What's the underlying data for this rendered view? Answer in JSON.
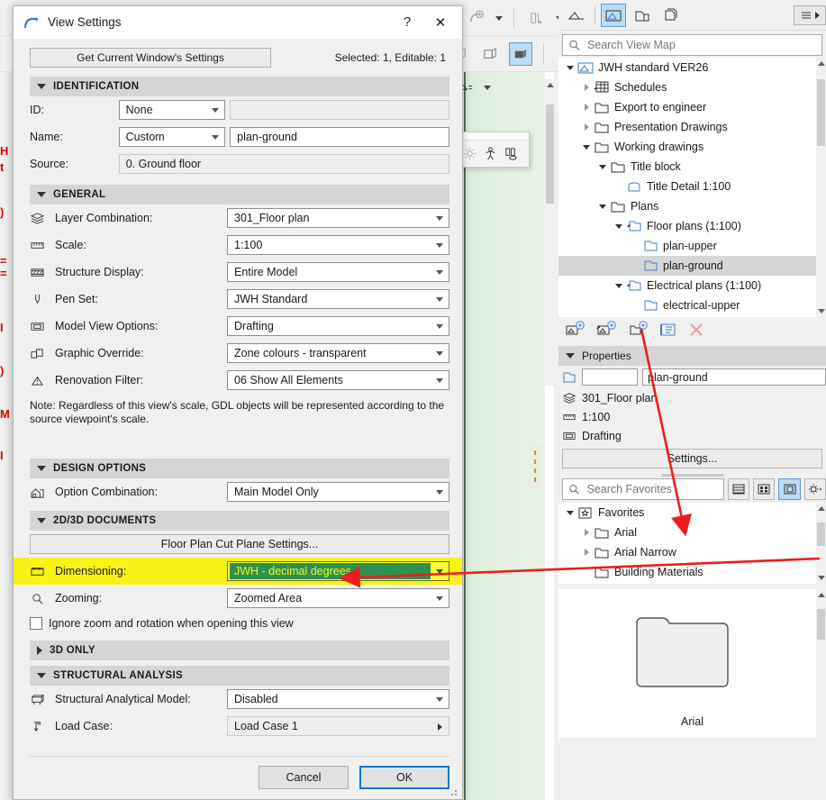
{
  "dialog": {
    "title": "View Settings",
    "help_label": "?",
    "close_label": "✕",
    "get_current_button": "Get Current Window's Settings",
    "selected_editable": "Selected: 1, Editable: 1",
    "groups": {
      "identification": {
        "title": "IDENTIFICATION",
        "rows": {
          "id_label": "ID:",
          "id_value": "None",
          "id_text": "",
          "name_label": "Name:",
          "name_value": "Custom",
          "name_text": "plan-ground",
          "source_label": "Source:",
          "source_value": "0. Ground floor"
        }
      },
      "general": {
        "title": "GENERAL",
        "rows": [
          {
            "label": "Layer Combination:",
            "value": "301_Floor plan",
            "icon": "layers-icon"
          },
          {
            "label": "Scale:",
            "value": "1:100",
            "icon": "ruler-icon"
          },
          {
            "label": "Structure Display:",
            "value": "Entire Model",
            "icon": "structure-icon"
          },
          {
            "label": "Pen Set:",
            "value": "JWH Standard",
            "icon": "pen-icon"
          },
          {
            "label": "Model View Options:",
            "value": "Drafting",
            "icon": "model-view-icon"
          },
          {
            "label": "Graphic Override:",
            "value": "Zone colours - transparent",
            "icon": "graphic-override-icon"
          },
          {
            "label": "Renovation Filter:",
            "value": "06 Show All Elements",
            "icon": "renovation-icon"
          }
        ],
        "note": "Note: Regardless of this view's scale, GDL objects will be represented according to the source viewpoint's scale."
      },
      "design_options": {
        "title": "DESIGN OPTIONS",
        "rows": [
          {
            "label": "Option Combination:",
            "value": "Main Model Only",
            "icon": "design-option-icon"
          }
        ]
      },
      "documents_2d3d": {
        "title": "2D/3D DOCUMENTS",
        "cut_plane_button": "Floor Plan Cut Plane Settings...",
        "rows": [
          {
            "label": "Dimensioning:",
            "value": "JWH - decimal degrees",
            "icon": "dimension-icon",
            "highlighted": true
          },
          {
            "label": "Zooming:",
            "value": "Zoomed Area",
            "icon": "magnifier-icon",
            "highlighted": false
          }
        ],
        "checkbox_label": "Ignore zoom and rotation when opening this view",
        "checkbox_checked": false
      },
      "three_d_only": {
        "title": "3D ONLY",
        "collapsed": true
      },
      "structural_analysis": {
        "title": "STRUCTURAL ANALYSIS",
        "rows": [
          {
            "label": "Structural Analytical Model:",
            "value": "Disabled",
            "icon": "structural-model-icon",
            "type": "combo"
          },
          {
            "label": "Load Case:",
            "value": "Load Case 1",
            "icon": "load-case-icon",
            "type": "popup"
          }
        ]
      }
    },
    "footer": {
      "cancel": "Cancel",
      "ok": "OK"
    }
  },
  "right_panel": {
    "tabs": [
      {
        "name": "project-map-tab",
        "icon": "project-map-icon",
        "selected": false
      },
      {
        "name": "view-map-tab",
        "icon": "view-map-icon",
        "selected": true
      },
      {
        "name": "layout-book-tab",
        "icon": "layout-book-icon",
        "selected": false
      },
      {
        "name": "publisher-sets-tab",
        "icon": "publisher-icon",
        "selected": false
      }
    ],
    "menu_icon": "hamburger-icon",
    "search": {
      "placeholder": "Search View Map",
      "value": ""
    },
    "tree": [
      {
        "label": "JWH standard VER26",
        "depth": 0,
        "twist": "down",
        "icon": "project-icon",
        "selected": false
      },
      {
        "label": "Schedules",
        "depth": 1,
        "twist": "right",
        "icon": "schedule-icon",
        "selected": false
      },
      {
        "label": "Export to engineer",
        "depth": 1,
        "twist": "right",
        "icon": "folder-icon",
        "selected": false
      },
      {
        "label": "Presentation Drawings",
        "depth": 1,
        "twist": "right",
        "icon": "folder-icon",
        "selected": false
      },
      {
        "label": "Working drawings",
        "depth": 1,
        "twist": "down",
        "icon": "folder-icon",
        "selected": false
      },
      {
        "label": "Title block",
        "depth": 2,
        "twist": "down",
        "icon": "folder-icon",
        "selected": false
      },
      {
        "label": "Title Detail 1:100",
        "depth": 3,
        "twist": "none",
        "icon": "detail-icon",
        "selected": false
      },
      {
        "label": "Plans",
        "depth": 2,
        "twist": "down",
        "icon": "folder-icon",
        "selected": false
      },
      {
        "label": "Floor plans (1:100)",
        "depth": 3,
        "twist": "down",
        "icon": "floorplan-set-icon",
        "selected": false
      },
      {
        "label": "plan-upper",
        "depth": 4,
        "twist": "none",
        "icon": "view-icon",
        "selected": false
      },
      {
        "label": "plan-ground",
        "depth": 4,
        "twist": "none",
        "icon": "view-icon",
        "selected": true
      },
      {
        "label": "Electrical plans (1:100)",
        "depth": 3,
        "twist": "down",
        "icon": "floorplan-set-icon",
        "selected": false
      },
      {
        "label": "electrical-upper",
        "depth": 4,
        "twist": "none",
        "icon": "view-icon",
        "selected": false
      }
    ],
    "tree_toolbar": [
      {
        "name": "save-view-button",
        "icon": "save-view-icon"
      },
      {
        "name": "save-clone-view-button",
        "icon": "save-clone-icon"
      },
      {
        "name": "new-folder-button",
        "icon": "new-folder-icon"
      },
      {
        "name": "view-settings-button",
        "icon": "settings-list-icon"
      },
      {
        "name": "delete-button",
        "icon": "delete-x-icon"
      }
    ],
    "properties": {
      "title": "Properties",
      "id_value": "",
      "name_value": "plan-ground",
      "layer_combination": "301_Floor plan",
      "scale": "1:100",
      "model_view_options": "Drafting",
      "settings_button": "Settings..."
    },
    "favorites": {
      "search_placeholder": "Search Favorites",
      "view_buttons": [
        {
          "name": "list-view-button",
          "icon": "list-icon",
          "selected": false
        },
        {
          "name": "grid-view-button",
          "icon": "grid-icon",
          "selected": false
        },
        {
          "name": "large-view-button",
          "icon": "large-preview-icon",
          "selected": true
        }
      ],
      "settings_icon": "gear-icon",
      "tree": [
        {
          "label": "Favorites",
          "depth": 0,
          "twist": "down",
          "icon": "favorites-star-icon"
        },
        {
          "label": "Arial",
          "depth": 1,
          "twist": "right",
          "icon": "folder-icon"
        },
        {
          "label": "Arial Narrow",
          "depth": 1,
          "twist": "right",
          "icon": "folder-icon"
        },
        {
          "label": "Building Materials",
          "depth": 1,
          "twist": "none",
          "icon": "folder-icon"
        }
      ],
      "preview_caption": "Arial"
    }
  },
  "background": {
    "left_fragments": [
      "H",
      "t",
      ")",
      "=",
      "=",
      "I",
      ")",
      "M",
      "I"
    ],
    "palette_icons": [
      "sun-icon",
      "person-front-icon",
      "person-side-icon"
    ]
  },
  "colors": {
    "highlight_yellow": "#f8f217",
    "selection_green": "#2e9150",
    "selection_text": "#f5f51a",
    "annotation_red": "#ee1c1c",
    "accent_blue": "#0078d7",
    "tree_selection": "#d6d6d6",
    "canvas_green": "#e4f2e2"
  }
}
